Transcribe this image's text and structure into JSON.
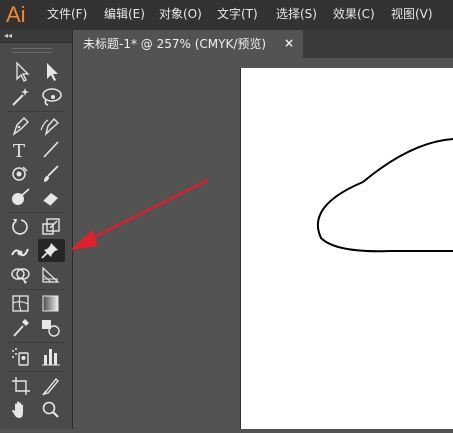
{
  "app": {
    "logo": "Ai",
    "menu": [
      {
        "label": "文件(F)"
      },
      {
        "label": "编辑(E)"
      },
      {
        "label": "对象(O)"
      },
      {
        "label": "文字(T)"
      },
      {
        "label": "选择(S)"
      },
      {
        "label": "效果(C)"
      },
      {
        "label": "视图(V)"
      }
    ]
  },
  "toolbox": {
    "collapse_glyph": "◂◂",
    "tools": [
      {
        "name": "selection-tool",
        "icon": "arrow-outline-icon"
      },
      {
        "name": "direct-selection-tool",
        "icon": "arrow-filled-icon"
      },
      {
        "name": "magic-wand-tool",
        "icon": "magic-wand-icon"
      },
      {
        "name": "lasso-tool",
        "icon": "lasso-icon"
      },
      {
        "name": "pen-tool",
        "icon": "pen-icon"
      },
      {
        "name": "curvature-tool",
        "icon": "curvature-pen-icon"
      },
      {
        "name": "type-tool",
        "icon": "type-icon",
        "glyph": "T"
      },
      {
        "name": "line-segment-tool",
        "icon": "line-icon"
      },
      {
        "name": "shaper-tool",
        "icon": "shaper-icon"
      },
      {
        "name": "paintbrush-tool",
        "icon": "brush-icon"
      },
      {
        "name": "blob-brush-tool",
        "icon": "blob-brush-icon"
      },
      {
        "name": "eraser-tool",
        "icon": "eraser-icon"
      },
      {
        "name": "rotate-tool",
        "icon": "rotate-icon"
      },
      {
        "name": "scale-tool",
        "icon": "scale-icon"
      },
      {
        "name": "width-tool",
        "icon": "width-icon"
      },
      {
        "name": "puppet-warp-tool",
        "icon": "pin-icon",
        "active": true
      },
      {
        "name": "shape-builder-tool",
        "icon": "shape-builder-icon"
      },
      {
        "name": "perspective-grid-tool",
        "icon": "perspective-grid-icon"
      },
      {
        "name": "mesh-tool",
        "icon": "mesh-icon"
      },
      {
        "name": "gradient-tool",
        "icon": "gradient-icon"
      },
      {
        "name": "eyedropper-tool",
        "icon": "eyedropper-icon"
      },
      {
        "name": "blend-tool",
        "icon": "blend-icon"
      },
      {
        "name": "symbol-sprayer-tool",
        "icon": "symbol-sprayer-icon"
      },
      {
        "name": "column-graph-tool",
        "icon": "column-graph-icon"
      },
      {
        "name": "artboard-tool",
        "icon": "artboard-icon"
      },
      {
        "name": "slice-tool",
        "icon": "slice-icon"
      },
      {
        "name": "hand-tool",
        "icon": "hand-icon"
      },
      {
        "name": "zoom-tool",
        "icon": "zoom-icon"
      }
    ]
  },
  "document": {
    "tab_title": "未标题-1* @ 257% (CMYK/预览)",
    "close_glyph": "×"
  },
  "colors": {
    "menubar": "#323232",
    "workspace": "#535353",
    "toolbox": "#4a4a4a",
    "logo": "#f18a2b",
    "annotation_arrow": "#e0202a"
  }
}
